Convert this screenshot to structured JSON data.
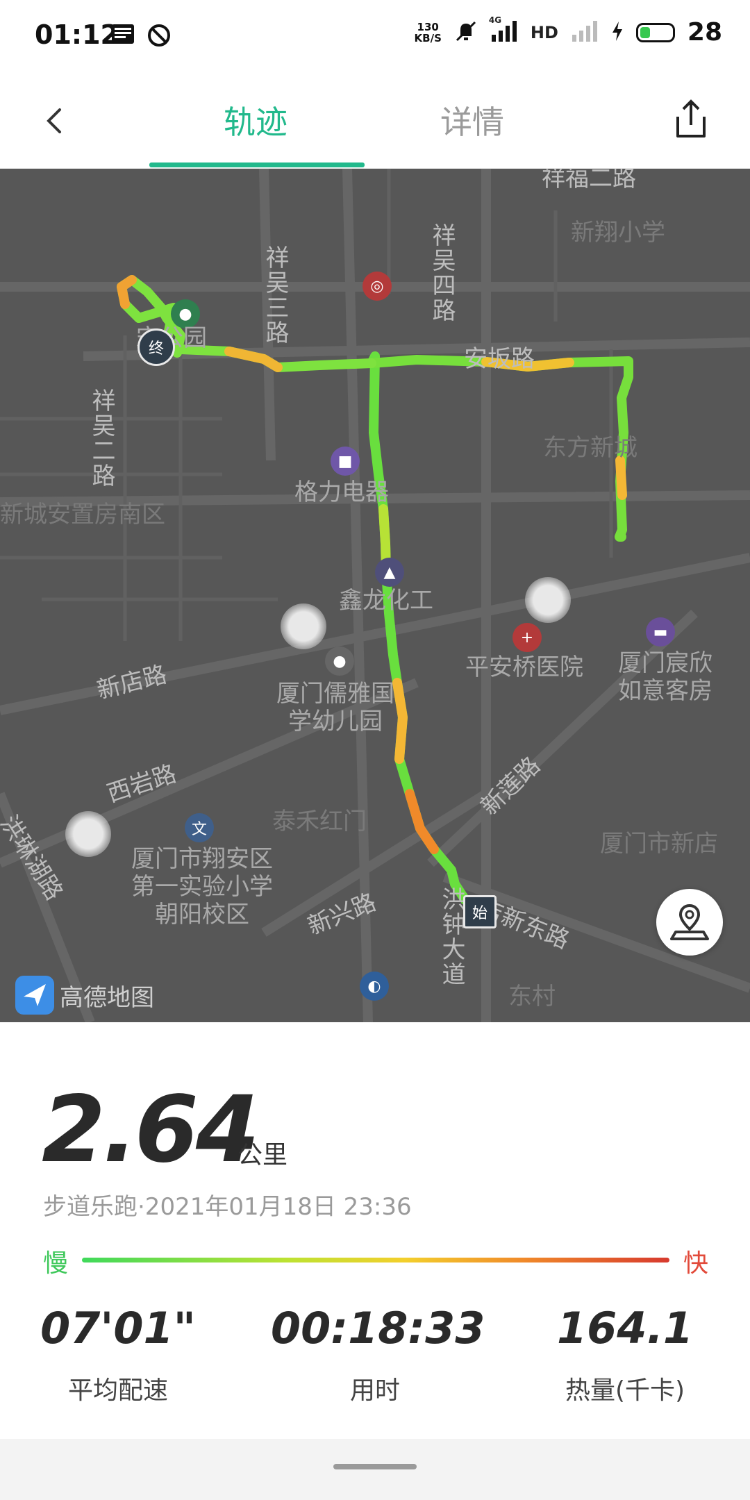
{
  "status_bar": {
    "time": "01:12",
    "net_speed_value": "130",
    "net_speed_unit": "KB/S",
    "signal_type": "4G",
    "hd": "HD",
    "battery": "28",
    "icons": [
      "news-icon",
      "dnd-icon",
      "mute-icon",
      "signal-icon",
      "hd-icon",
      "signal-empty-icon",
      "charging-icon",
      "battery-icon"
    ]
  },
  "header": {
    "tabs": [
      {
        "label": "轨迹",
        "active": true
      },
      {
        "label": "详情",
        "active": false
      }
    ],
    "accent_color": "#22b98c"
  },
  "map": {
    "roads": [
      "祥福二路",
      "祥吴四路",
      "祥吴三路",
      "祥吴二路",
      "安坂路",
      "新店路",
      "西岩路",
      "新莲路",
      "洪琳湖路",
      "新兴路",
      "洪钟大道",
      "店新东路"
    ],
    "pois": [
      "新翔小学",
      "东方新城",
      "格力电器",
      "新城安置房南区",
      "鑫龙化工",
      "平安桥医院",
      "厦门宸欣如意客房",
      "厦门儒雅国学幼儿园",
      "泰禾红门",
      "厦门市新店",
      "厦门市翔安区第一实验小学朝阳校区",
      "东村",
      "宋公园"
    ],
    "start_marker": "始",
    "end_marker": "终",
    "provider": "高德地图"
  },
  "stats": {
    "distance": "2.64",
    "distance_unit": "公里",
    "subtitle": "步道乐跑·2021年01月18日 23:36",
    "legend_slow": "慢",
    "legend_fast": "快",
    "items": [
      {
        "value": "07'01\"",
        "label": "平均配速"
      },
      {
        "value": "00:18:33",
        "label": "用时"
      },
      {
        "value": "164.1",
        "label": "热量(千卡)"
      }
    ]
  }
}
